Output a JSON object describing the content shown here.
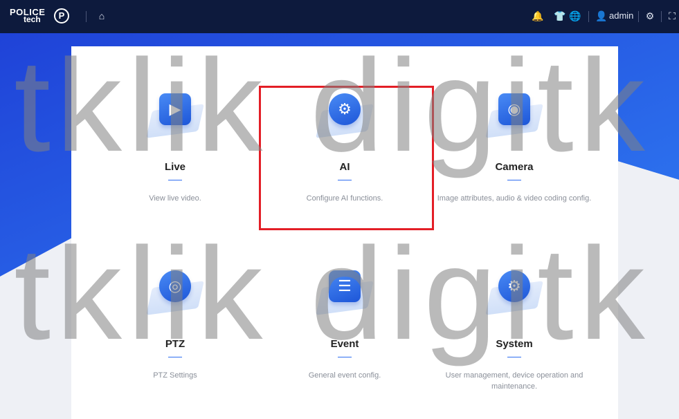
{
  "topbar": {
    "logo_line1": "POLICE",
    "logo_line2": "tech",
    "logo_badge": "P",
    "user_name": "admin",
    "icons": [
      "home-icon",
      "bell-icon",
      "shirt-icon",
      "globe-icon",
      "user-icon",
      "gear-icon",
      "fullscreen-icon"
    ]
  },
  "tiles": [
    {
      "title": "Live",
      "desc": "View live video.",
      "glyph": "▶",
      "icon": "live-video-icon"
    },
    {
      "title": "AI",
      "desc": "Configure AI functions.",
      "glyph": "⚙",
      "icon": "ai-head-icon"
    },
    {
      "title": "Camera",
      "desc": "Image attributes, audio & video coding config.",
      "glyph": "◉",
      "icon": "camera-icon"
    },
    {
      "title": "PTZ",
      "desc": "PTZ Settings",
      "glyph": "◎",
      "icon": "ptz-control-icon"
    },
    {
      "title": "Event",
      "desc": "General event config.",
      "glyph": "☰",
      "icon": "event-list-icon"
    },
    {
      "title": "System",
      "desc": "User management, device operation and maintenance.",
      "glyph": "⚙",
      "icon": "system-gear-icon"
    }
  ],
  "watermark": "itklik digitk",
  "colors": {
    "accent": "#2d6cf0",
    "highlight": "#e31e26",
    "topbar": "#0d1a3d"
  }
}
